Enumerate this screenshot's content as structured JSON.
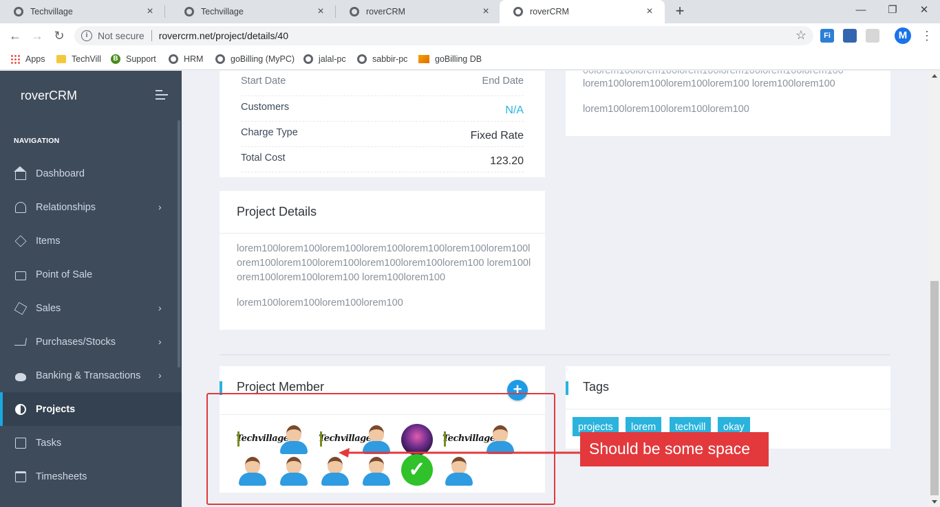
{
  "browser": {
    "tabs": [
      {
        "title": "Techvillage"
      },
      {
        "title": "Techvillage"
      },
      {
        "title": "roverCRM"
      },
      {
        "title": "roverCRM",
        "active": true
      }
    ],
    "security_label": "Not secure",
    "url": "rovercrm.net/project/details/40",
    "profile_initial": "M",
    "extensions": [
      "Fi"
    ],
    "bookmarks": [
      "Apps",
      "TechVill",
      "Support",
      "HRM",
      "goBilling (MyPC)",
      "jalal-pc",
      "sabbir-pc",
      "goBilling DB"
    ]
  },
  "sidebar": {
    "brand": "roverCRM",
    "nav_heading": "NAVIGATION",
    "items": [
      {
        "label": "Dashboard",
        "icon": "home-icon"
      },
      {
        "label": "Relationships",
        "icon": "users-icon",
        "has_submenu": true
      },
      {
        "label": "Items",
        "icon": "layers-icon"
      },
      {
        "label": "Point of Sale",
        "icon": "briefcase-icon"
      },
      {
        "label": "Sales",
        "icon": "box-icon",
        "has_submenu": true
      },
      {
        "label": "Purchases/Stocks",
        "icon": "cart-icon",
        "has_submenu": true
      },
      {
        "label": "Banking & Transactions",
        "icon": "piggy-bank-icon",
        "has_submenu": true
      },
      {
        "label": "Projects",
        "icon": "contrast-icon",
        "active": true
      },
      {
        "label": "Tasks",
        "icon": "clipboard-icon"
      },
      {
        "label": "Timesheets",
        "icon": "calendar-clock-icon"
      }
    ]
  },
  "project_info": {
    "start_date_label": "Start Date",
    "end_date_label": "End Date",
    "customers_label": "Customers",
    "customers_value": "N/A",
    "charge_type_label": "Charge Type",
    "charge_type_value": "Fixed Rate",
    "total_cost_label": "Total Cost",
    "total_cost_value": "123.20"
  },
  "top_description": {
    "line_partial": "00lorem100lorem100lorem100lorem100lorem100lorem100",
    "line2": "lorem100lorem100lorem100lorem100 lorem100lorem100",
    "line3": "lorem100lorem100lorem100lorem100"
  },
  "project_details": {
    "title": "Project Details",
    "paragraph1": "lorem100lorem100lorem100lorem100lorem100lorem100lorem100lorem100lorem100lorem100lorem100lorem100lorem100 lorem100lorem100lorem100lorem100 lorem100lorem100",
    "paragraph2": "lorem100lorem100lorem100lorem100"
  },
  "project_member": {
    "title": "Project Member",
    "add_label": "+",
    "logo_text": "Techvillage",
    "members": [
      "logo",
      "person",
      "logo",
      "person",
      "photo",
      "logo",
      "person",
      "person",
      "person",
      "person",
      "person",
      "check",
      "person"
    ]
  },
  "tags": {
    "title": "Tags",
    "items": [
      "projects",
      "lorem",
      "techvill",
      "okay"
    ]
  },
  "annotation": {
    "label": "Should be some space",
    "color": "#e3393c"
  }
}
